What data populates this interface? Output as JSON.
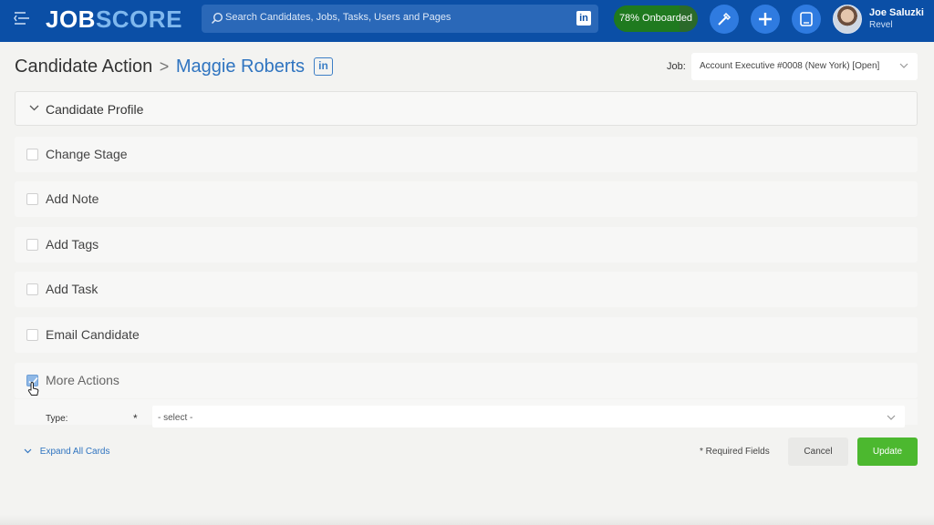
{
  "header": {
    "logo_job": "JOB",
    "logo_score": "SCORE",
    "search_placeholder": "Search Candidates, Jobs, Tasks, Users and Pages",
    "linkedin_glyph": "in",
    "onboard_label": "78% Onboarded",
    "onboard_percent": 78,
    "user_name": "Joe Saluzki",
    "user_company": "Revel",
    "colors": {
      "bar": "#0b4fa6",
      "accent": "#2f7be0",
      "onboard": "#1f7a1f"
    },
    "icons": [
      "menu-icon",
      "search-icon",
      "linkedin-icon",
      "wand-icon",
      "add-icon",
      "tablet-icon"
    ]
  },
  "page": {
    "title": "Candidate Action",
    "separator": ">",
    "candidate": "Maggie Roberts",
    "linkedin_glyph": "in",
    "job_label": "Job:",
    "job_value": "Account Executive #0008 (New York) [Open]"
  },
  "profile": {
    "label": "Candidate Profile",
    "expanded": false
  },
  "actions": [
    {
      "label": "Change Stage",
      "checked": false
    },
    {
      "label": "Add Note",
      "checked": false
    },
    {
      "label": "Add Tags",
      "checked": false
    },
    {
      "label": "Add Task",
      "checked": false
    },
    {
      "label": "Email Candidate",
      "checked": false
    },
    {
      "label": "More Actions",
      "checked": true
    }
  ],
  "more_actions": {
    "type_label": "Type:",
    "required_mark": "*",
    "type_value": "- select -"
  },
  "footer": {
    "expand_all": "Expand All Cards",
    "required_note": "* Required Fields",
    "cancel": "Cancel",
    "update": "Update",
    "colors": {
      "update": "#4cb82f"
    }
  }
}
